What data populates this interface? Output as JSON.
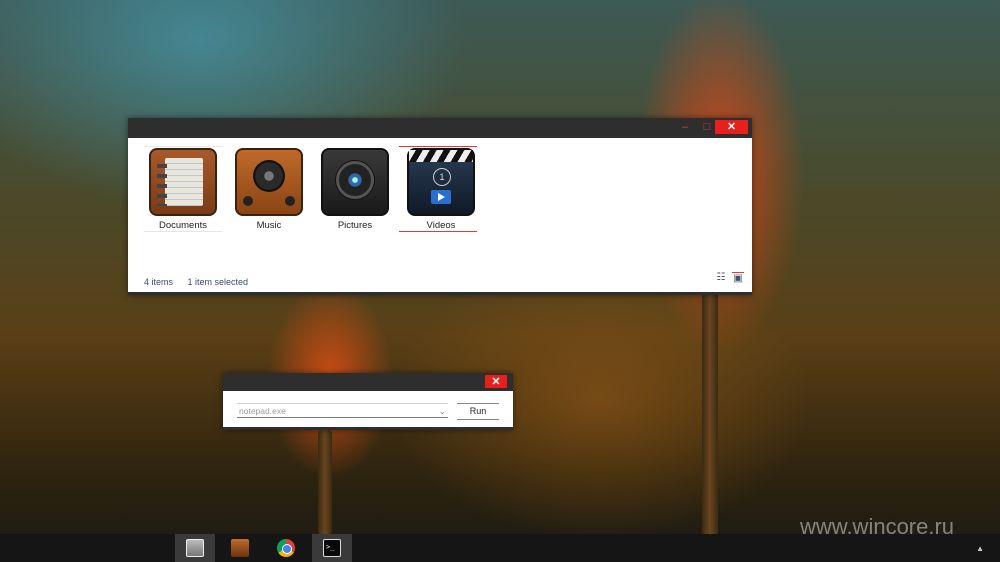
{
  "explorer": {
    "controls": {
      "minimize": "–",
      "maximize": "□",
      "close": "✕"
    },
    "items": [
      {
        "label": "Documents",
        "icon": "notebook-icon"
      },
      {
        "label": "Music",
        "icon": "speaker-icon"
      },
      {
        "label": "Pictures",
        "icon": "camera-lens-icon"
      },
      {
        "label": "Videos",
        "icon": "clapperboard-icon"
      }
    ],
    "status": {
      "count": "4 items",
      "selected": "1 item selected"
    },
    "views": {
      "details": "☷",
      "tiles": "▣"
    }
  },
  "run_dialog": {
    "close": "✕",
    "input_value": "notepad.exe",
    "chevron": "⌄",
    "run_label": "Run"
  },
  "taskbar": {
    "items": [
      "file-explorer-icon",
      "music-player-icon",
      "chrome-icon",
      "command-prompt-icon"
    ],
    "cmd_glyph": ">_",
    "tray_arrow": "▲"
  },
  "watermark": "www.wincore.ru",
  "colors": {
    "accent": "#e53935",
    "titlebar": "#2e2e2e",
    "taskbar": "#151515"
  }
}
